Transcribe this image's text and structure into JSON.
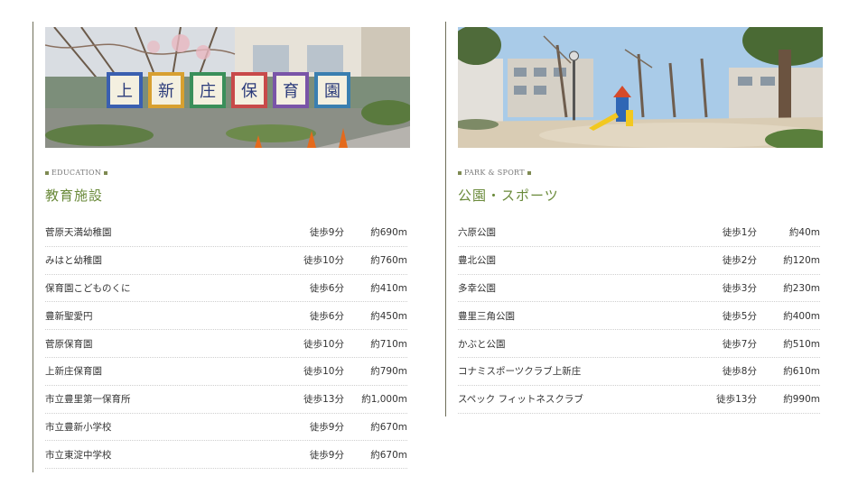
{
  "education": {
    "category": "EDUCATION",
    "title": "教育施設",
    "items": [
      {
        "name": "菅原天満幼稚園",
        "walk": "徒歩9分",
        "distance": "約690m"
      },
      {
        "name": "みはと幼稚園",
        "walk": "徒歩10分",
        "distance": "約760m"
      },
      {
        "name": "保育園こどものくに",
        "walk": "徒歩6分",
        "distance": "約410m"
      },
      {
        "name": "豊新聖愛円",
        "walk": "徒歩6分",
        "distance": "約450m"
      },
      {
        "name": "菅原保育園",
        "walk": "徒歩10分",
        "distance": "約710m"
      },
      {
        "name": "上新庄保育園",
        "walk": "徒歩10分",
        "distance": "約790m"
      },
      {
        "name": "市立豊里第一保育所",
        "walk": "徒歩13分",
        "distance": "約1,000m"
      },
      {
        "name": "市立豊新小学校",
        "walk": "徒歩9分",
        "distance": "約670m"
      },
      {
        "name": "市立東淀中学校",
        "walk": "徒歩9分",
        "distance": "約670m"
      }
    ]
  },
  "park_sport": {
    "category": "PARK & SPORT",
    "title": "公園・スポーツ",
    "items": [
      {
        "name": "六原公園",
        "walk": "徒歩1分",
        "distance": "約40m"
      },
      {
        "name": "豊北公園",
        "walk": "徒歩2分",
        "distance": "約120m"
      },
      {
        "name": "多幸公園",
        "walk": "徒歩3分",
        "distance": "約230m"
      },
      {
        "name": "豊里三角公園",
        "walk": "徒歩5分",
        "distance": "約400m"
      },
      {
        "name": "かぶと公園",
        "walk": "徒歩7分",
        "distance": "約510m"
      },
      {
        "name": "コナミスポーツクラブ上新庄",
        "walk": "徒歩8分",
        "distance": "約610m"
      },
      {
        "name": "スペック フィットネスクラブ",
        "walk": "徒歩13分",
        "distance": "約990m"
      }
    ]
  },
  "photo_sign_chars": [
    "上",
    "新",
    "庄",
    "保",
    "育",
    "園"
  ]
}
